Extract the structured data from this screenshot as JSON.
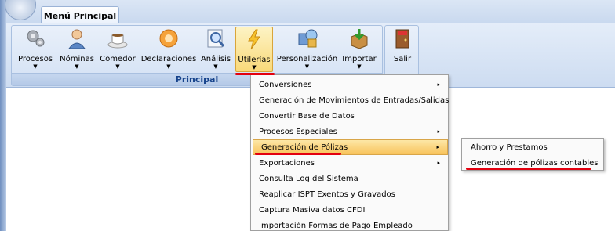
{
  "tab": {
    "label": "Menú Principal"
  },
  "ribbon": {
    "group_label": "Principal",
    "buttons": [
      {
        "label": "Procesos",
        "icon": "gears-icon"
      },
      {
        "label": "Nóminas",
        "icon": "user-icon"
      },
      {
        "label": "Comedor",
        "icon": "coffee-cup-icon"
      },
      {
        "label": "Declaraciones",
        "icon": "orange-circle-icon"
      },
      {
        "label": "Análisis",
        "icon": "magnifier-icon"
      },
      {
        "label": "Utilerías",
        "icon": "lightning-icon"
      },
      {
        "label": "Personalización",
        "icon": "personalization-icon"
      },
      {
        "label": "Importar",
        "icon": "import-box-icon"
      },
      {
        "label": "Salir",
        "icon": "exit-door-icon"
      }
    ],
    "active_button": "Utilerías"
  },
  "menu": {
    "items": [
      {
        "label": "Conversiones",
        "has_submenu": true
      },
      {
        "label": "Generación de Movimientos de Entradas/Salidas",
        "has_submenu": false
      },
      {
        "label": "Convertir Base de Datos",
        "has_submenu": false
      },
      {
        "label": "Procesos Especiales",
        "has_submenu": true
      },
      {
        "label": "Generación de Pólizas",
        "has_submenu": true,
        "highlighted": true
      },
      {
        "label": "Exportaciones",
        "has_submenu": true
      },
      {
        "label": "Consulta Log del Sistema",
        "has_submenu": false
      },
      {
        "label": "Reaplicar ISPT Exentos y Gravados",
        "has_submenu": false
      },
      {
        "label": "Captura Masiva datos CFDI",
        "has_submenu": false
      },
      {
        "label": "Importación Formas de Pago Empleado",
        "has_submenu": false
      }
    ],
    "submenu_arrow": "▸"
  },
  "submenu": {
    "items": [
      {
        "label": "Ahorro y Prestamos"
      },
      {
        "label": "Generación de pólizas contables"
      }
    ]
  },
  "colors": {
    "highlight": "#f8c35c",
    "annotation_red": "#e3000f",
    "group_label": "#15428b"
  }
}
